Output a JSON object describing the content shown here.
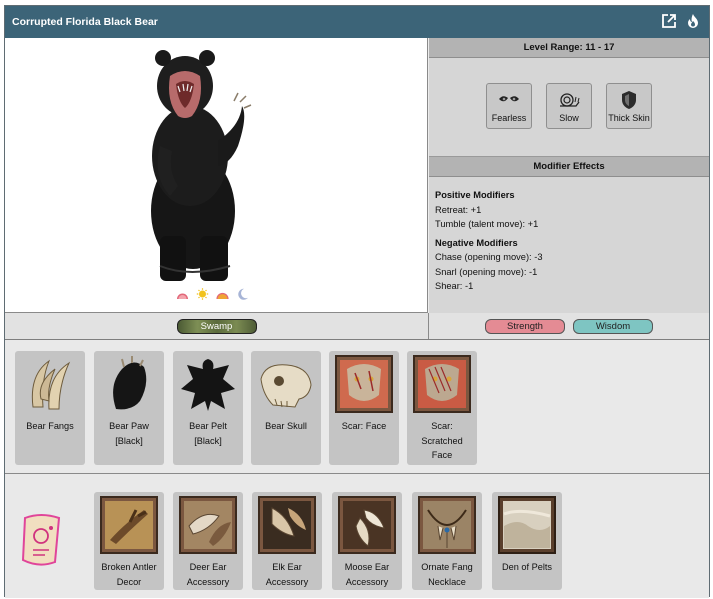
{
  "window": {
    "title": "Corrupted Florida Black Bear",
    "icons": [
      "external-link-icon",
      "fire-icon"
    ]
  },
  "level_range": {
    "label": "Level Range: 11 - 17"
  },
  "traits": [
    {
      "label": "Fearless",
      "icon": "eyes-icon"
    },
    {
      "label": "Slow",
      "icon": "snail-icon"
    },
    {
      "label": "Thick Skin",
      "icon": "shield-icon"
    }
  ],
  "modifier_effects": {
    "title": "Modifier Effects",
    "positive_title": "Positive Modifiers",
    "positive": [
      "Retreat: +1",
      "Tumble (talent move): +1"
    ],
    "negative_title": "Negative Modifiers",
    "negative": [
      "Chase (opening move): -3",
      "Snarl (opening move): -1",
      "Shear: -1"
    ]
  },
  "time_of_day_icons": [
    "dawn-icon",
    "day-icon",
    "dusk-icon",
    "night-icon"
  ],
  "habitat": {
    "label": "Swamp"
  },
  "stats": [
    "Strength",
    "Wisdom"
  ],
  "drops": [
    {
      "name": "Bear Fangs"
    },
    {
      "name": "Bear Paw",
      "sub": "[Black]"
    },
    {
      "name": "Bear Pelt",
      "sub": "[Black]"
    },
    {
      "name": "Bear Skull"
    },
    {
      "name": "Scar: Face"
    },
    {
      "name": "Scar:",
      "sub": "Scratched",
      "sub2": "Face"
    }
  ],
  "accessories": [
    {
      "name": "Broken Antler",
      "sub": "Decor"
    },
    {
      "name": "Deer Ear",
      "sub": "Accessory"
    },
    {
      "name": "Elk Ear",
      "sub": "Accessory"
    },
    {
      "name": "Moose Ear",
      "sub": "Accessory"
    },
    {
      "name": "Ornate Fang",
      "sub": "Necklace"
    },
    {
      "name": "Den of Pelts"
    }
  ],
  "colors": {
    "titlebar": "#3c6478",
    "strength": "#e48b94",
    "wisdom": "#7ec5c2"
  }
}
